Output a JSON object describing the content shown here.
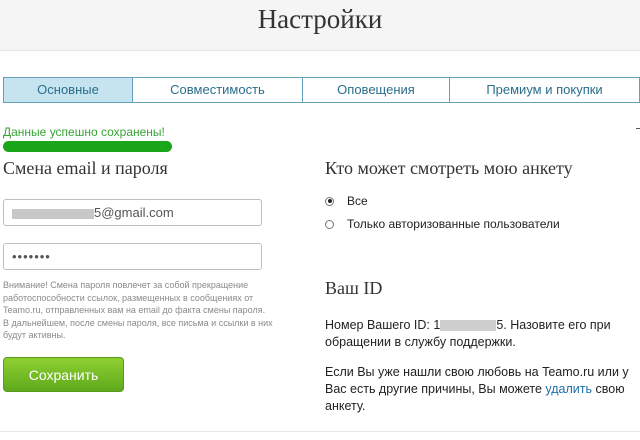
{
  "page": {
    "title": "Настройки"
  },
  "tabs": [
    {
      "label": "Основные",
      "active": true
    },
    {
      "label": "Совместимость",
      "active": false
    },
    {
      "label": "Оповещения",
      "active": false
    },
    {
      "label": "Премиум и покупки",
      "active": false
    }
  ],
  "status": {
    "success_message": "Данные успешно сохранены!"
  },
  "account_form": {
    "title": "Смена email и пароля",
    "email_value": "5@gmail.com",
    "password_value": "•••••••",
    "warning": "Внимание! Смена пароля повлечет за собой прекращение работоспособности ссылок, размещенных в сообщениях от Teamo.ru, отправленных вам на email до факта смены пароля. В дальнейшем, после смены пароля, все письма и ссылки в них будут активны.",
    "save_label": "Сохранить"
  },
  "visibility": {
    "title": "Кто может смотреть мою анкету",
    "options": [
      {
        "label": "Все",
        "checked": true
      },
      {
        "label": "Только авторизованные пользователи",
        "checked": false
      }
    ]
  },
  "your_id": {
    "title": "Ваш ID",
    "prefix": "Номер Вашего ID: 1",
    "suffix": "5. Назовите его при обращении в службу поддержки.",
    "leave_text": "Если Вы уже нашли свою любовь на Teamo.ru или у Вас есть другие причины, Вы можете",
    "delete_link": "удалить",
    "leave_tail": "свою анкету."
  },
  "colors": {
    "success": "#37a337",
    "tab_active_bg": "#c6e4f0",
    "tab_text": "#2a6e8c",
    "button_green": "#6fba22",
    "link": "#1e6fa8"
  }
}
